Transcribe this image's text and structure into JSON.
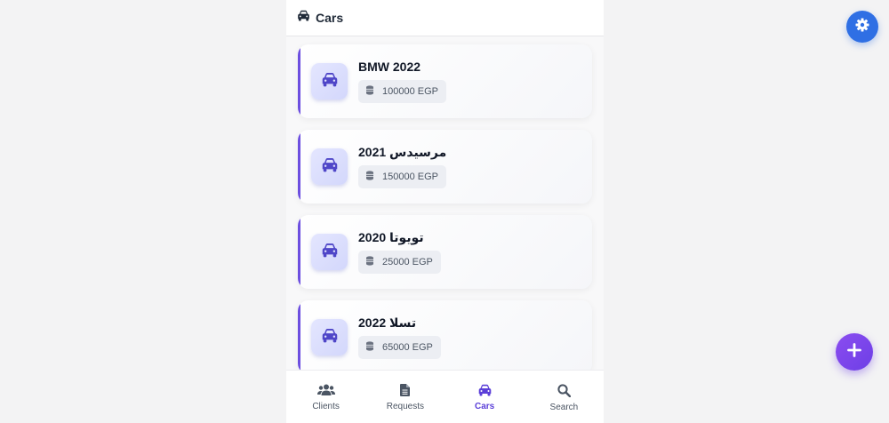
{
  "header": {
    "title": "Cars",
    "icon": "car-icon"
  },
  "cars": [
    {
      "name": "BMW 2022",
      "price": "100000 EGP"
    },
    {
      "name": "مرسيدس 2021",
      "price": "150000 EGP"
    },
    {
      "name": "تويوتا 2020",
      "price": "25000 EGP"
    },
    {
      "name": "تسلا 2022",
      "price": "65000 EGP"
    }
  ],
  "nav": {
    "items": [
      {
        "label": "Clients",
        "icon": "users-icon"
      },
      {
        "label": "Requests",
        "icon": "file-icon"
      },
      {
        "label": "Cars",
        "icon": "car-icon",
        "active": true
      },
      {
        "label": "Search",
        "icon": "search-icon"
      }
    ]
  },
  "fabs": {
    "settings_icon": "gear-icon",
    "add_icon": "plus-icon"
  },
  "colors": {
    "accent": "#6d4fe0",
    "car_icon": "#4f46c8",
    "active_nav": "#5b3fd8",
    "settings_button": "#2f6fe4",
    "add_button": "#7c44ec"
  }
}
